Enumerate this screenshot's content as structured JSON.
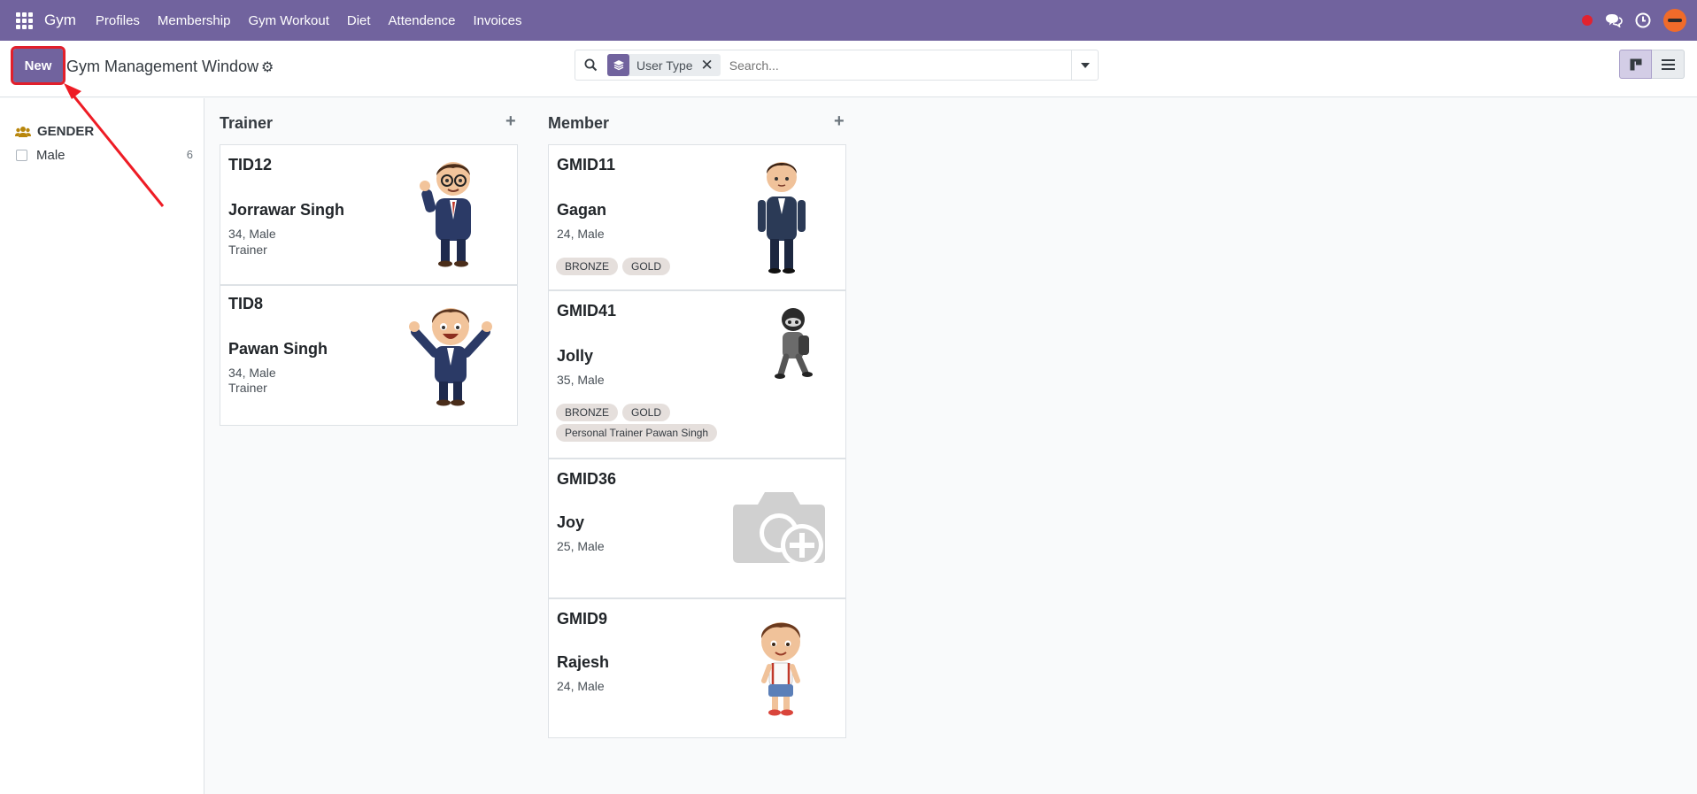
{
  "navbar": {
    "brand": "Gym",
    "menu": [
      "Profiles",
      "Membership",
      "Gym Workout",
      "Diet",
      "Attendence",
      "Invoices"
    ],
    "colors": {
      "brand": "#71639e",
      "accent_alert": "#e2222f",
      "avatar": "#f06b2a"
    }
  },
  "control_panel": {
    "new_label": "New",
    "title": "Gym Management Window",
    "search": {
      "facet_label": "User Type",
      "placeholder": "Search..."
    }
  },
  "sidebar": {
    "group_label": "GENDER",
    "filters": [
      {
        "label": "Male",
        "count": "6"
      }
    ]
  },
  "columns": [
    {
      "title": "Trainer",
      "cards": [
        {
          "id": "TID12",
          "name": "Jorrawar Singh",
          "meta": "34, Male",
          "role": "Trainer",
          "image": "trainer-cartoon-thumbs-up"
        },
        {
          "id": "TID8",
          "name": "Pawan Singh",
          "meta": "34, Male",
          "role": "Trainer",
          "image": "trainer-cartoon-cheering"
        }
      ]
    },
    {
      "title": "Member",
      "cards": [
        {
          "id": "GMID11",
          "name": "Gagan",
          "meta": "24, Male",
          "tags": [
            "BRONZE",
            "GOLD"
          ],
          "image": "member-cartoon-suit"
        },
        {
          "id": "GMID41",
          "name": "Jolly",
          "meta": "35, Male",
          "tags": [
            "BRONZE",
            "GOLD"
          ],
          "tags2": [
            "Personal Trainer Pawan Singh"
          ],
          "image": "member-cartoon-hooded"
        },
        {
          "id": "GMID36",
          "name": "Joy",
          "meta": "25, Male",
          "image": "camera-placeholder-icon"
        },
        {
          "id": "GMID9",
          "name": "Rajesh",
          "meta": "24, Male",
          "image": "member-cartoon-boy"
        }
      ]
    }
  ]
}
